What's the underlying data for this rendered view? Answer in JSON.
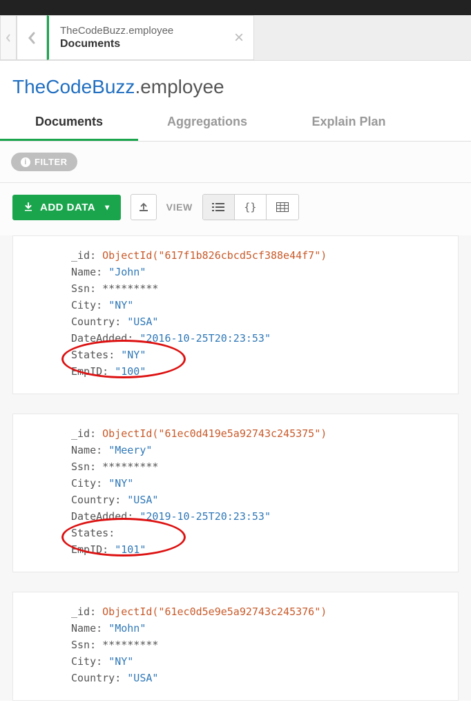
{
  "tab": {
    "title": "TheCodeBuzz.employee",
    "subtitle": "Documents"
  },
  "namespace": {
    "db": "TheCodeBuzz",
    "collection": ".employee"
  },
  "viewTabs": {
    "documents": "Documents",
    "aggregations": "Aggregations",
    "explain": "Explain Plan"
  },
  "filter": {
    "label": "FILTER"
  },
  "toolbar": {
    "addData": "ADD DATA",
    "viewLabel": "VIEW"
  },
  "docs": [
    {
      "fields": [
        {
          "k": "_id",
          "fn": "ObjectId(\"617f1b826cbcd5cf388e44f7\")"
        },
        {
          "k": "Name",
          "v": "\"John\""
        },
        {
          "k": "Ssn",
          "p": "*********"
        },
        {
          "k": "City",
          "v": "\"NY\""
        },
        {
          "k": "Country",
          "v": "\"USA\""
        },
        {
          "k": "DateAdded",
          "v": "\"2016-10-25T20:23:53\""
        },
        {
          "k": "States",
          "v": "\"NY\""
        },
        {
          "k": "EmpID",
          "v": "\"100\""
        }
      ],
      "circleTop": 150
    },
    {
      "fields": [
        {
          "k": "_id",
          "fn": "ObjectId(\"61ec0d419e5a92743c245375\")"
        },
        {
          "k": "Name",
          "v": "\"Meery\""
        },
        {
          "k": "Ssn",
          "p": "*********"
        },
        {
          "k": "City",
          "v": "\"NY\""
        },
        {
          "k": "Country",
          "v": "\"USA\""
        },
        {
          "k": "DateAdded",
          "v": "\"2019-10-25T20:23:53\""
        },
        {
          "k": "States",
          "p": ""
        },
        {
          "k": "EmpID",
          "v": "\"101\""
        }
      ],
      "circleTop": 150
    },
    {
      "fields": [
        {
          "k": "_id",
          "fn": "ObjectId(\"61ec0d5e9e5a92743c245376\")"
        },
        {
          "k": "Name",
          "v": "\"Mohn\""
        },
        {
          "k": "Ssn",
          "p": "*********"
        },
        {
          "k": "City",
          "v": "\"NY\""
        },
        {
          "k": "Country",
          "v": "\"USA\""
        }
      ]
    }
  ]
}
